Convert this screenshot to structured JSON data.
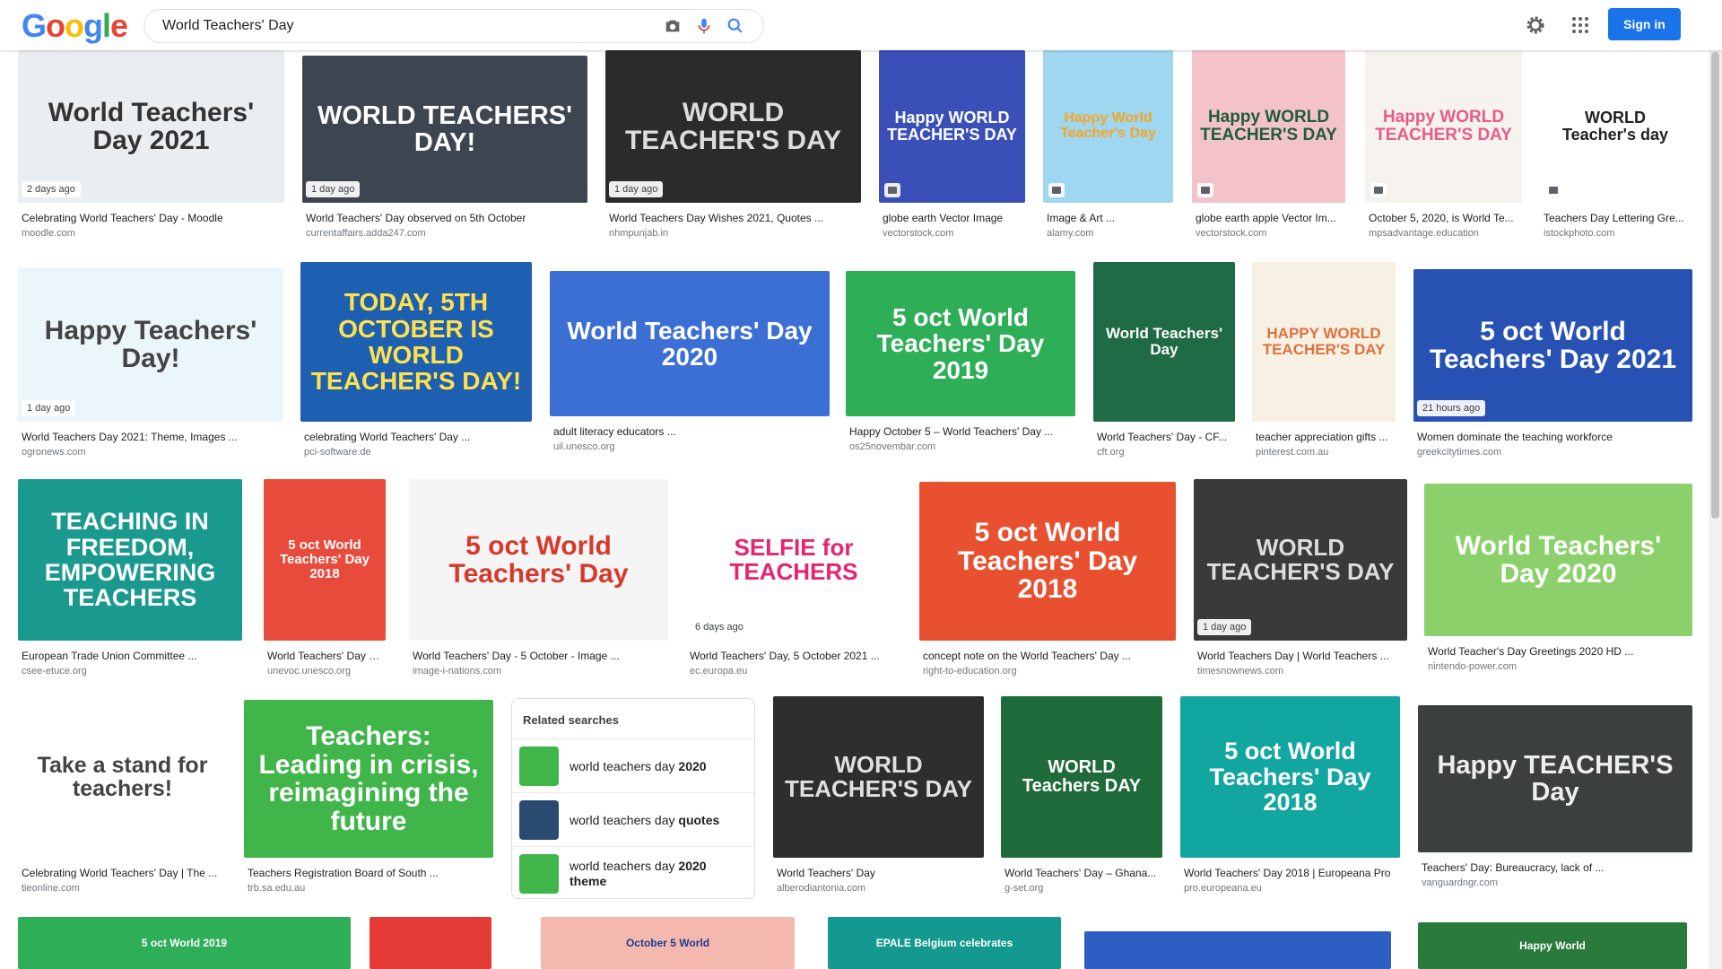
{
  "search": {
    "query": "World Teachers' Day"
  },
  "header": {
    "sign_in": "Sign in",
    "logo_letters": [
      {
        "ch": "G",
        "color": "#4285f4"
      },
      {
        "ch": "o",
        "color": "#ea4335"
      },
      {
        "ch": "o",
        "color": "#fbbc05"
      },
      {
        "ch": "g",
        "color": "#4285f4"
      },
      {
        "ch": "l",
        "color": "#34a853"
      },
      {
        "ch": "e",
        "color": "#ea4335"
      }
    ]
  },
  "cards": [
    {
      "title": "Celebrating World Teachers' Day - Moodle",
      "source": "moodle.com",
      "badge": "2 days ago",
      "img": "World Teachers' Day 2021",
      "bg": "#e9eef2",
      "fg": "#333"
    },
    {
      "title": "World Teachers' Day observed on 5th October",
      "source": "currentaffairs.adda247.com",
      "badge": "1 day ago",
      "img": "WORLD TEACHERS' DAY!",
      "bg": "#3d4650",
      "fg": "#ffffff"
    },
    {
      "title": "World Teachers Day Wishes 2021, Quotes ...",
      "source": "nhmpunjab.in",
      "badge": "1 day ago",
      "img": "WORLD TEACHER'S DAY",
      "bg": "#2b2b2b",
      "fg": "#dddddd"
    },
    {
      "title": "globe earth Vector Image",
      "source": "vectorstock.com",
      "badge": "",
      "img": "Happy WORLD TEACHER'S DAY",
      "bg": "#3a50b8",
      "fg": "#ffffff"
    },
    {
      "title": "Image & Art ...",
      "source": "alamy.com",
      "badge": "",
      "img": "Happy World Teacher's Day",
      "bg": "#9fd6f0",
      "fg": "#f5a623"
    },
    {
      "title": "globe earth apple Vector Im...",
      "source": "vectorstock.com",
      "badge": "",
      "img": "Happy WORLD TEACHER'S DAY",
      "bg": "#f3c3c9",
      "fg": "#1e5c3a"
    },
    {
      "title": "October 5, 2020, is World Te...",
      "source": "mpsadvantage.education",
      "badge": "",
      "img": "Happy WORLD TEACHER'S DAY",
      "bg": "#f6f3ee",
      "fg": "#e85a8a"
    },
    {
      "title": "Teachers Day Lettering Gre...",
      "source": "istockphoto.com",
      "badge": "",
      "img": "WORLD Teacher's day",
      "bg": "#ffffff",
      "fg": "#222222"
    },
    {
      "title": "World Teachers Day 2021: Theme, Images ...",
      "source": "ogronews.com",
      "badge": "1 day ago",
      "img": "Happy Teachers' Day!",
      "bg": "#eaf6f9",
      "fg": "#444"
    },
    {
      "title": "celebrating World Teachers' Day ...",
      "source": "pci-software.de",
      "badge": "",
      "img": "TODAY, 5TH OCTOBER IS WORLD TEACHER'S DAY!",
      "bg": "#1d5fb0",
      "fg": "#ffe14d"
    },
    {
      "title": "adult literacy educators ...",
      "source": "uil.unesco.org",
      "badge": "",
      "img": "World Teachers' Day 2020",
      "bg": "#3b6fd4",
      "fg": "#ffffff"
    },
    {
      "title": "Happy October 5 – World Teachers' Day ...",
      "source": "os25novembar.com",
      "badge": "",
      "img": "5 oct World Teachers' Day 2019",
      "bg": "#2fae58",
      "fg": "#ffffff"
    },
    {
      "title": "World Teachers' Day - CF...",
      "source": "cft.org",
      "badge": "",
      "img": "World Teachers' Day",
      "bg": "#1f6b45",
      "fg": "#ffffff"
    },
    {
      "title": "teacher appreciation gifts ...",
      "source": "pinterest.com.au",
      "badge": "",
      "img": "HAPPY WORLD TEACHER'S DAY",
      "bg": "#f7f1e3",
      "fg": "#e0703b"
    },
    {
      "title": "Women dominate the teaching workforce",
      "source": "greekcitytimes.com",
      "badge": "21 hours ago",
      "img": "5 oct World Teachers' Day 2021",
      "bg": "#2751b3",
      "fg": "#ffffff"
    },
    {
      "title": "European Trade Union Committee ...",
      "source": "csee-etuce.org",
      "badge": "",
      "img": "TEACHING IN FREEDOM, EMPOWERING TEACHERS",
      "bg": "#1a9a8f",
      "fg": "#ffffff"
    },
    {
      "title": "World Teachers' Day 20...",
      "source": "unevoc.unesco.org",
      "badge": "",
      "img": "5 oct World Teachers' Day 2018",
      "bg": "#e84b3c",
      "fg": "#ffffff"
    },
    {
      "title": "World Teachers' Day - 5 October - Image ...",
      "source": "image-i-nations.com",
      "badge": "",
      "img": "5 oct World Teachers' Day",
      "bg": "#f5f5f5",
      "fg": "#d6392b"
    },
    {
      "title": "World Teachers' Day, 5 October 2021 ...",
      "source": "ec.europa.eu",
      "badge": "6 days ago",
      "img": "SELFIE for TEACHERS",
      "bg": "#ffffff",
      "fg": "#e6246f"
    },
    {
      "title": "concept note on the World Teachers' Day ...",
      "source": "right-to-education.org",
      "badge": "",
      "img": "5 oct World Teachers' Day 2018",
      "bg": "#e8502f",
      "fg": "#ffffff"
    },
    {
      "title": "World Teachers Day | World Teachers ...",
      "source": "timesnownews.com",
      "badge": "1 day ago",
      "img": "WORLD TEACHER'S DAY",
      "bg": "#3a3a3a",
      "fg": "#dddddd"
    },
    {
      "title": "World Teacher's Day Greetings 2020 HD ...",
      "source": "nintendo-power.com",
      "badge": "",
      "img": "World Teachers' Day 2020",
      "bg": "#8bd06a",
      "fg": "#ffffff"
    },
    {
      "title": "Celebrating World Teachers' Day | The ...",
      "source": "tieonline.com",
      "badge": "",
      "img": "Take a stand for teachers!",
      "bg": "#ffffff",
      "fg": "#444444"
    },
    {
      "title": "Teachers Registration Board of South ...",
      "source": "trb.sa.edu.au",
      "badge": "",
      "img": "Teachers: Leading in crisis, reimagining the future",
      "bg": "#3fb54a",
      "fg": "#ffffff"
    },
    {
      "title": "World Teachers' Day",
      "source": "alberodiantonia.com",
      "badge": "",
      "img": "WORLD TEACHER'S DAY",
      "bg": "#2e2e2e",
      "fg": "#e0e0e0"
    },
    {
      "title": "World Teachers' Day – Ghana...",
      "source": "g-set.org",
      "badge": "",
      "img": "WORLD Teachers DAY",
      "bg": "#1f6b3c",
      "fg": "#ffffff"
    },
    {
      "title": "World Teachers' Day 2018 | Europeana Pro",
      "source": "pro.europeana.eu",
      "badge": "",
      "img": "5 oct World Teachers' Day 2018",
      "bg": "#11a6a0",
      "fg": "#ffffff"
    },
    {
      "title": "Teachers' Day: Bureaucracy, lack of ...",
      "source": "vanguardngr.com",
      "badge": "",
      "img": "Happy TEACHER'S Day",
      "bg": "#3b3f3e",
      "fg": "#eeeeee"
    },
    {
      "title": "",
      "source": "",
      "badge": "",
      "img": "5 oct World 2019",
      "bg": "#2fae58",
      "fg": "#ffffff"
    },
    {
      "title": "",
      "source": "",
      "badge": "",
      "img": "",
      "bg": "#e53935",
      "fg": "#ffffff"
    },
    {
      "title": "",
      "source": "",
      "badge": "",
      "img": "October 5 World",
      "bg": "#f4b8ae",
      "fg": "#1d3c8f"
    },
    {
      "title": "",
      "source": "",
      "badge": "",
      "img": "EPALE Belgium celebrates",
      "bg": "#13998f",
      "fg": "#ffffff"
    },
    {
      "title": "",
      "source": "",
      "badge": "",
      "img": "",
      "bg": "#2d5ec4",
      "fg": "#ffffff"
    },
    {
      "title": "",
      "source": "",
      "badge": "",
      "img": "Happy World",
      "bg": "#2a7a3b",
      "fg": "#ffffff"
    }
  ],
  "related": {
    "title": "Related searches",
    "items": [
      {
        "prefix": "world teachers day ",
        "bold": "2020",
        "suffix": "",
        "color": "#3fb54a"
      },
      {
        "prefix": "world teachers day ",
        "bold": "quotes",
        "suffix": "",
        "color": "#2b4a6f"
      },
      {
        "prefix": "world teachers day ",
        "bold": "2020",
        "suffix": "theme",
        "color": "#3fb54a"
      }
    ]
  }
}
